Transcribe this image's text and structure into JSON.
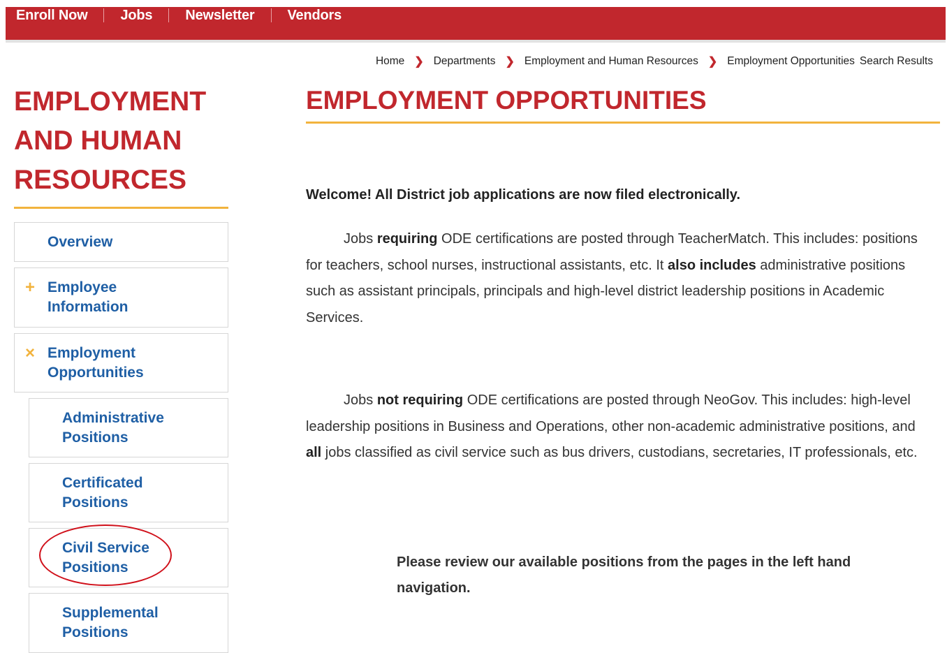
{
  "topnav": {
    "items": [
      "Enroll Now",
      "Jobs",
      "Newsletter",
      "Vendors"
    ]
  },
  "breadcrumb": {
    "items": [
      "Home",
      "Departments",
      "Employment and Human Resources",
      "Employment Opportunities"
    ],
    "extra": "Search Results"
  },
  "sidebar": {
    "title_lines": [
      "EMPLOYMENT",
      "AND HUMAN",
      "RESOURCES"
    ],
    "items": [
      {
        "label": "Overview",
        "mark": ""
      },
      {
        "label_lines": [
          "Employee",
          "Information"
        ],
        "mark": "+"
      },
      {
        "label_lines": [
          "Employment",
          "Opportunities"
        ],
        "mark": "×"
      }
    ],
    "subitems": [
      {
        "label_lines": [
          "Administrative",
          "Positions"
        ]
      },
      {
        "label_lines": [
          "Certificated",
          "Positions"
        ]
      },
      {
        "label_lines": [
          "Civil Service",
          "Positions"
        ]
      },
      {
        "label_lines": [
          "Supplemental",
          "Positions"
        ]
      }
    ]
  },
  "main": {
    "title": "EMPLOYMENT OPPORTUNITIES",
    "welcome": "Welcome! All District job applications are now filed electronically.",
    "para1": {
      "a": "Jobs ",
      "b1": "requiring",
      "c": " ODE certifications are posted through TeacherMatch. This includes: positions for teachers, school nurses, instructional assistants, etc. It ",
      "b2": "also includes",
      "d": " administrative positions such as assistant principals, principals and high-level district leadership positions in Academic Services."
    },
    "para2": {
      "a": "Jobs ",
      "b1": "not requiring",
      "c": " ODE certifications are posted through NeoGov. This includes: high-level leadership positions in Business and Operations, other non-academic administrative positions, and ",
      "b2": "all",
      "d": " jobs classified as civil service such as bus drivers, custodians, secretaries, IT professionals, etc."
    },
    "note": "Please review our available positions from the pages in the left hand navigation."
  }
}
